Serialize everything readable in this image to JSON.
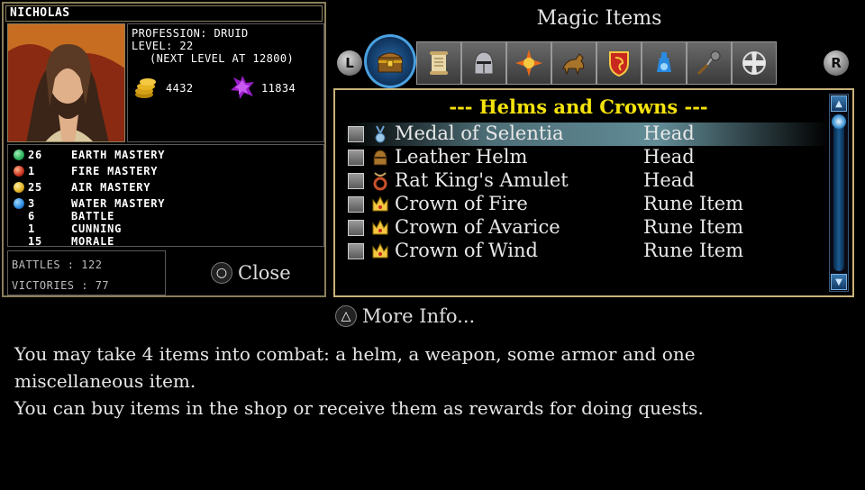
{
  "character": {
    "name": "NICHOLAS",
    "profession": "PROFESSION: DRUID",
    "level": "LEVEL: 22",
    "next_level": "(NEXT LEVEL AT 12800)",
    "gold": "4432",
    "crystals": "11834"
  },
  "stats": [
    {
      "value": "26",
      "label": "EARTH MASTERY",
      "orb_color": "#2bb05a"
    },
    {
      "value": "1",
      "label": "FIRE MASTERY",
      "orb_color": "#c8321e"
    },
    {
      "value": "25",
      "label": "AIR MASTERY",
      "orb_color": "#e0b020"
    },
    {
      "value": "3",
      "label": "WATER MASTERY",
      "orb_color": "#2a8ae0"
    },
    {
      "value": "6",
      "label": "BATTLE"
    },
    {
      "value": "1",
      "label": "CUNNING"
    },
    {
      "value": "15",
      "label": "MORALE"
    }
  ],
  "battles": "BATTLES : 122",
  "victories": "VICTORIES : 77",
  "close_label": "Close",
  "panel": {
    "title": "Magic Items",
    "left_shoulder": "L",
    "right_shoulder": "R",
    "tabs": [
      {
        "icon": "treasure-chest-icon",
        "selected": true
      },
      {
        "icon": "scroll-icon"
      },
      {
        "icon": "helmet-icon"
      },
      {
        "icon": "sunburst-icon"
      },
      {
        "icon": "horse-icon"
      },
      {
        "icon": "dragon-shield-icon"
      },
      {
        "icon": "potion-icon"
      },
      {
        "icon": "flail-icon"
      },
      {
        "icon": "cross-icon"
      }
    ]
  },
  "list": {
    "header": "--- Helms and Crowns ---",
    "items": [
      {
        "name": "Medal of Selentia",
        "slot": "Head",
        "icon": "medal-icon"
      },
      {
        "name": "Leather Helm",
        "slot": "Head",
        "icon": "helm-icon"
      },
      {
        "name": "Rat King's Amulet",
        "slot": "Head",
        "icon": "amulet-icon"
      },
      {
        "name": "Crown of Fire",
        "slot": "Rune Item",
        "icon": "crown-icon"
      },
      {
        "name": "Crown of Avarice",
        "slot": "Rune Item",
        "icon": "crown-icon"
      },
      {
        "name": "Crown of Wind",
        "slot": "Rune Item",
        "icon": "crown-icon"
      }
    ]
  },
  "more_info_label": "More Info...",
  "description": {
    "line1": "You may take 4 items into combat: a helm, a weapon, some armor and one",
    "line2": "miscellaneous item.",
    "line3": "You can buy items in the shop or receive them as rewards for doing quests."
  },
  "colors": {
    "header_yellow": "#f4e20c",
    "panel_border": "#c8b27a",
    "accent_blue": "#2a6aa8"
  }
}
